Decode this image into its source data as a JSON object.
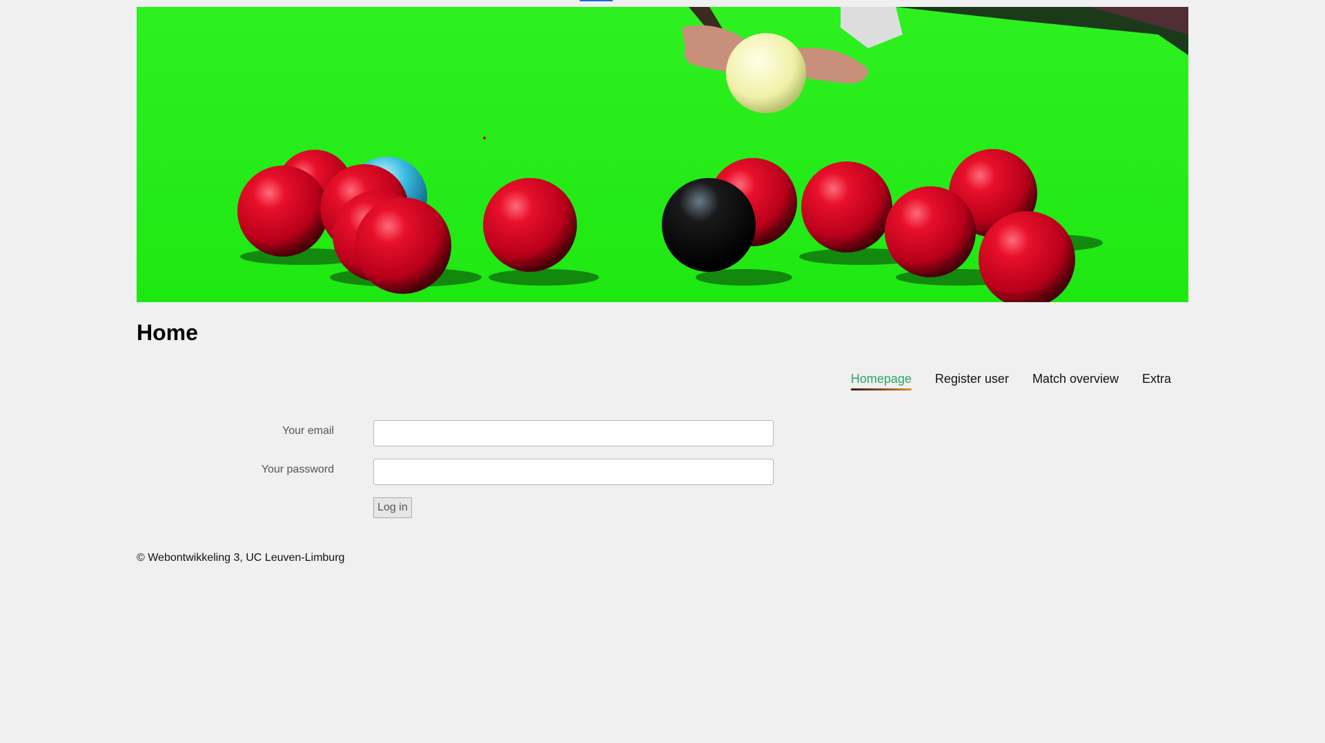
{
  "header": {
    "title": "Home",
    "banner_image": "snooker-balls-on-green-table"
  },
  "nav": {
    "items": [
      {
        "label": "Homepage",
        "active": true
      },
      {
        "label": "Register user",
        "active": false
      },
      {
        "label": "Match overview",
        "active": false
      },
      {
        "label": "Extra",
        "active": false
      }
    ]
  },
  "login_form": {
    "email_label": "Your email",
    "email_value": "",
    "password_label": "Your password",
    "password_value": "",
    "submit_label": "Log in"
  },
  "footer": {
    "text": "© Webontwikkeling 3, UC Leuven-Limburg"
  },
  "colors": {
    "background": "#f0f0f0",
    "active_nav": "#2aa56a",
    "table_green": "#22f01a"
  }
}
